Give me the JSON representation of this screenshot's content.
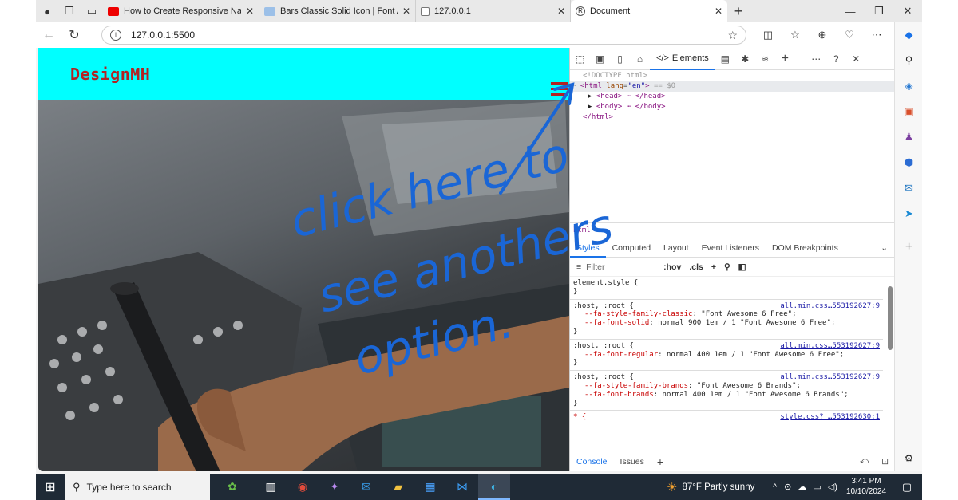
{
  "colors": {
    "header_bg": "#00ffff",
    "logo": "#b22222",
    "annotation": "#1a66d6",
    "taskbar": "#1f2a36"
  },
  "tabs": [
    {
      "title": "How to Create Responsive Naviga",
      "favicon": "youtube-icon"
    },
    {
      "title": "Bars Classic Solid Icon | Font Awe",
      "favicon": "fontawesome-icon"
    },
    {
      "title": "127.0.0.1",
      "favicon": "page-icon"
    },
    {
      "title": "Document",
      "favicon": "r-circle-icon",
      "active": true
    }
  ],
  "address": {
    "url": "127.0.0.1:5500"
  },
  "page": {
    "logo": "DesignMH"
  },
  "annotation": {
    "lines": [
      "click here to",
      "see anothers",
      "option."
    ]
  },
  "devtools": {
    "elements_tab": "Elements",
    "dom": {
      "doctype": "<!DOCTYPE html>",
      "html_open": "<html",
      "lang_attr": "lang",
      "lang_val": "\"en\"",
      "html_close_br": ">",
      "eq": "== $0",
      "head": "<head> ⋯ </head>",
      "body": "<body> ⋯ </body>",
      "html_end": "</html>"
    },
    "breadcrumb": "html",
    "subtabs": [
      "Styles",
      "Computed",
      "Layout",
      "Event Listeners",
      "DOM Breakpoints"
    ],
    "filter_placeholder": "Filter",
    "filter_hov": ":hov",
    "filter_cls": ".cls",
    "rules": {
      "r0": {
        "selector": "element.style {",
        "close": "}"
      },
      "r1": {
        "selector": ":host, :root {",
        "source": "all.min.css…553192627:9",
        "p1n": "--fa-style-family-classic",
        "p1v": ": \"Font Awesome 6 Free\";",
        "p2n": "--fa-font-solid",
        "p2v": ": normal 900 1em / 1 \"Font Awesome 6 Free\";",
        "close": "}"
      },
      "r2": {
        "selector": ":host, :root {",
        "source": "all.min.css…553192627:9",
        "p1n": "--fa-font-regular",
        "p1v": ": normal 400 1em / 1 \"Font Awesome 6 Free\";",
        "close": "}"
      },
      "r3": {
        "selector": ":host, :root {",
        "source": "all.min.css…553192627:9",
        "p1n": "--fa-style-family-brands",
        "p1v": ": \"Font Awesome 6 Brands\";",
        "p2n": "--fa-font-brands",
        "p2v": ": normal 400 1em / 1 \"Font Awesome 6 Brands\";",
        "close": "}"
      },
      "r4": {
        "selector": "* {",
        "source": "style.css? …553192630:1"
      }
    },
    "drawer": {
      "console": "Console",
      "issues": "Issues"
    }
  },
  "taskbar": {
    "search_placeholder": "Type here to search",
    "weather": "87°F  Partly sunny",
    "time": "3:41 PM",
    "date": "10/10/2024"
  }
}
